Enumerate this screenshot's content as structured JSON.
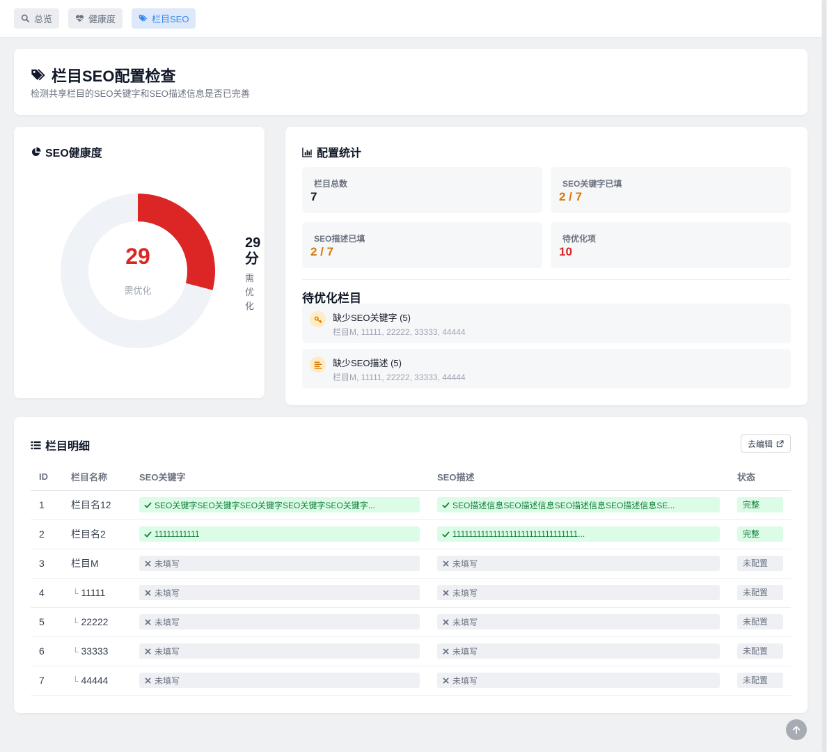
{
  "nav": {
    "tabs": [
      {
        "label": "总览",
        "icon": "search-icon"
      },
      {
        "label": "健康度",
        "icon": "heartbeat-icon"
      },
      {
        "label": "栏目SEO",
        "icon": "tags-icon",
        "active": true
      }
    ]
  },
  "header": {
    "title": "栏目SEO配置检查",
    "subtitle": "检测共享栏目的SEO关键字和SEO描述信息是否已完善"
  },
  "health": {
    "title": "SEO健康度",
    "score": "29",
    "score_value": 29,
    "score_label": "需优化",
    "side_score": "29分",
    "side_label": "需优化",
    "colors": {
      "arc": "#dc2626",
      "track": "#eff2f7"
    }
  },
  "stats": {
    "title": "配置统计",
    "items": [
      {
        "label": "栏目总数",
        "value": "7",
        "color": "#111827"
      },
      {
        "label": "SEO关键字已填",
        "value": "2 / 7",
        "color": "#d97706"
      },
      {
        "label": "SEO描述已填",
        "value": "2 / 7",
        "color": "#d97706"
      },
      {
        "label": "待优化项",
        "value": "10",
        "color": "#dc2626"
      }
    ]
  },
  "pending": {
    "title": "待优化栏目",
    "items": [
      {
        "name": "缺少SEO关键字 (5)",
        "list": "栏目M, 11111, 22222, 33333, 44444",
        "icon": "key-icon"
      },
      {
        "name": "缺少SEO描述 (5)",
        "list": "栏目M, 11111, 22222, 33333, 44444",
        "icon": "align-left-icon"
      }
    ]
  },
  "detail": {
    "title": "栏目明细",
    "edit_label": "去编辑",
    "columns": [
      "ID",
      "栏目名称",
      "SEO关键字",
      "SEO描述",
      "状态"
    ],
    "rows": [
      {
        "id": "1",
        "name": "栏目名12",
        "child": false,
        "kw": "SEO关键字SEO关键字SEO关键字SEO关键字SEO关键字...",
        "kw_ok": true,
        "desc": "SEO描述信息SEO描述信息SEO描述信息SEO描述信息SE...",
        "desc_ok": true,
        "status": "完整",
        "status_ok": true
      },
      {
        "id": "2",
        "name": "栏目名2",
        "child": false,
        "kw": "11111111111",
        "kw_ok": true,
        "desc": "1111111111111111111111111111111...",
        "desc_ok": true,
        "status": "完整",
        "status_ok": true
      },
      {
        "id": "3",
        "name": "栏目M",
        "child": false,
        "kw": "未填写",
        "kw_ok": false,
        "desc": "未填写",
        "desc_ok": false,
        "status": "未配置",
        "status_ok": false
      },
      {
        "id": "4",
        "name": "11111",
        "child": true,
        "kw": "未填写",
        "kw_ok": false,
        "desc": "未填写",
        "desc_ok": false,
        "status": "未配置",
        "status_ok": false
      },
      {
        "id": "5",
        "name": "22222",
        "child": true,
        "kw": "未填写",
        "kw_ok": false,
        "desc": "未填写",
        "desc_ok": false,
        "status": "未配置",
        "status_ok": false
      },
      {
        "id": "6",
        "name": "33333",
        "child": true,
        "kw": "未填写",
        "kw_ok": false,
        "desc": "未填写",
        "desc_ok": false,
        "status": "未配置",
        "status_ok": false
      },
      {
        "id": "7",
        "name": "44444",
        "child": true,
        "kw": "未填写",
        "kw_ok": false,
        "desc": "未填写",
        "desc_ok": false,
        "status": "未配置",
        "status_ok": false
      }
    ],
    "indent_glyph": "└"
  }
}
